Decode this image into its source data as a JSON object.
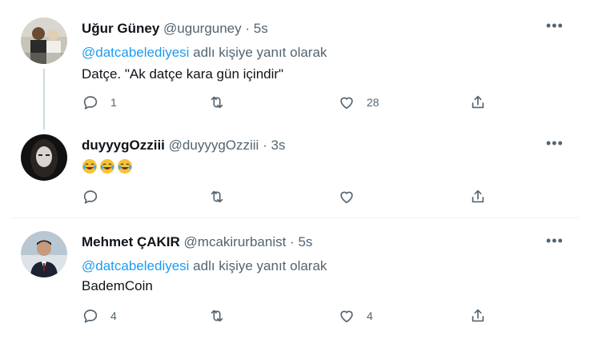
{
  "tweets": [
    {
      "name": "Uğur Güney",
      "handle": "@ugurguney",
      "dot": "·",
      "time": "5s",
      "reply_mention": "@datcabelediyesi",
      "reply_suffix": " adlı kişiye yanıt olarak",
      "text": "Datçe. \"Ak datçe kara gün içindir\"",
      "reply_count": "1",
      "retweet_count": "",
      "like_count": "28"
    },
    {
      "name": "duyyygOzziii",
      "handle": "@duyyygOzziii",
      "dot": "·",
      "time": "3s",
      "reply_count": "",
      "retweet_count": "",
      "like_count": ""
    },
    {
      "name": "Mehmet ÇAKIR",
      "handle": "@mcakirurbanist",
      "dot": "·",
      "time": "5s",
      "reply_mention": "@datcabelediyesi",
      "reply_suffix": " adlı kişiye yanıt olarak",
      "text": "BademCoin",
      "reply_count": "4",
      "retweet_count": "",
      "like_count": "4"
    }
  ],
  "icons": {
    "more": "more-icon",
    "reply": "reply-icon",
    "retweet": "retweet-icon",
    "like": "heart-icon",
    "share": "share-icon",
    "emoji": "laughing-tears-emoji"
  },
  "colors": {
    "accent": "#1d9bf0",
    "secondary_text": "#536471",
    "primary_text": "#0f1419",
    "thread_line": "#cfd9de"
  }
}
